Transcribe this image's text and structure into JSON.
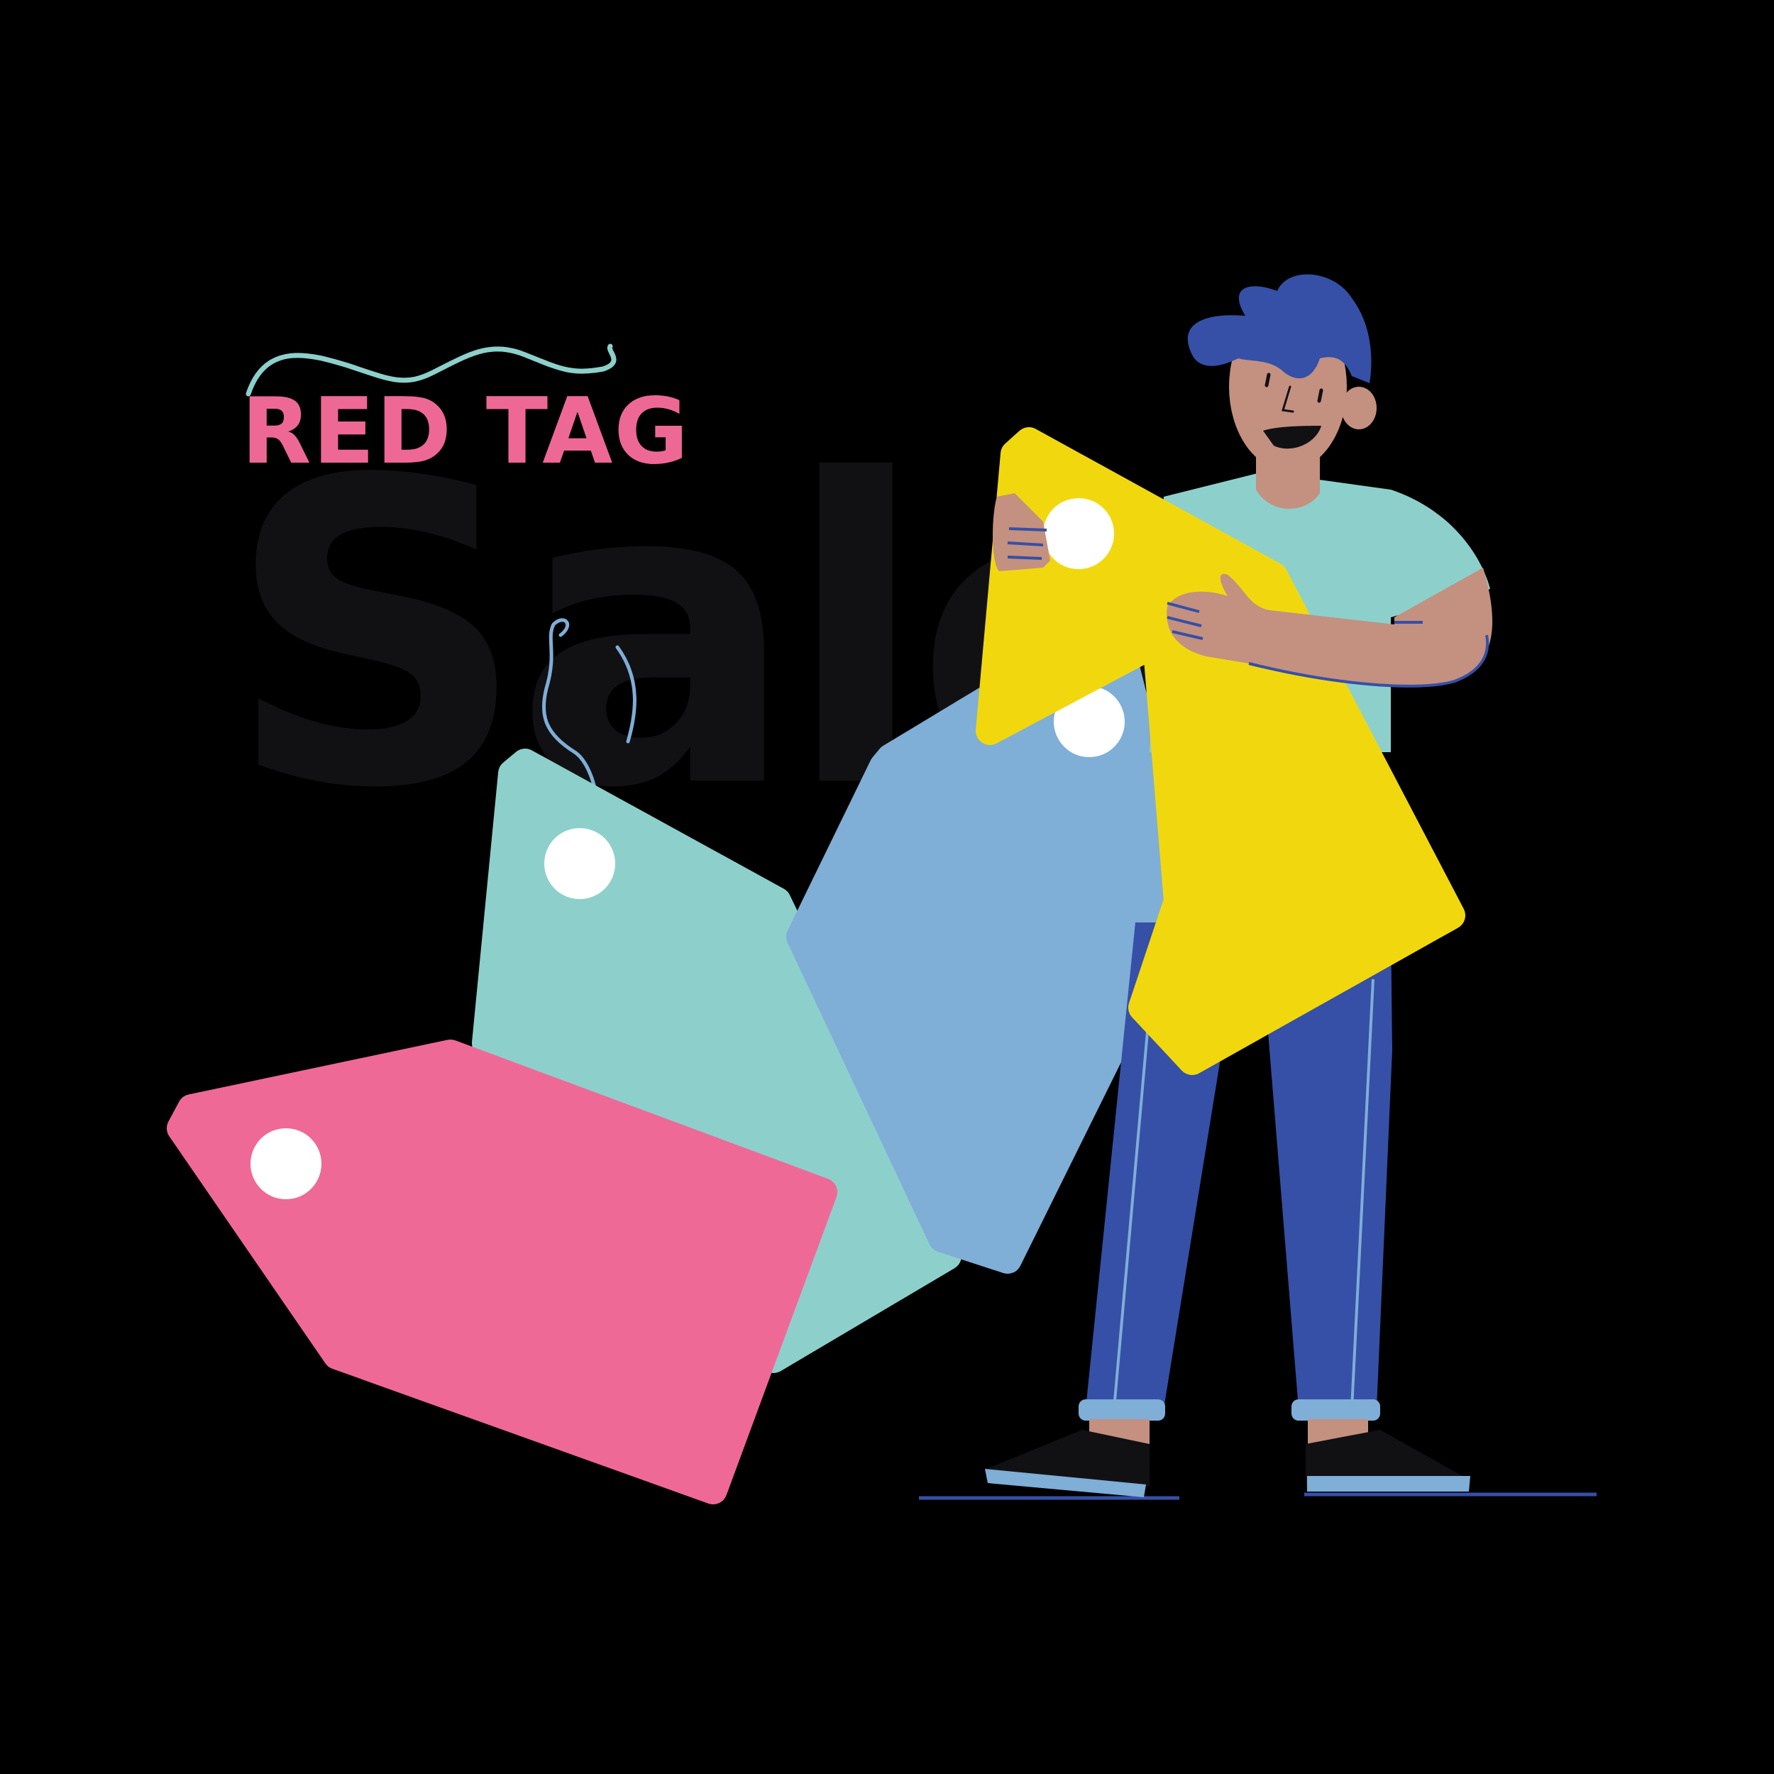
{
  "title": {
    "eyebrow": "RED TAG",
    "main": "Sale"
  },
  "colors": {
    "background": "#000000",
    "eyebrow_text": "#ee6895",
    "main_text": "#111114",
    "wave": "#8dd0cb",
    "tag_pink": "#ef6996",
    "tag_teal": "#8dd0cb",
    "tag_blue": "#7faed7",
    "tag_yellow": "#f1d80e",
    "tag_hole": "#ffffff",
    "string": "#7faed7",
    "hair": "#3550a6",
    "skin": "#c49080",
    "shirt": "#8dd0cb",
    "pants": "#3550a6",
    "cuffs": "#7faed7",
    "shoes": "#111114",
    "soles": "#7faed7",
    "ground_line": "#3550a6"
  },
  "icons": [
    "wave-decoration",
    "price-tag-icon",
    "person-illustration"
  ]
}
